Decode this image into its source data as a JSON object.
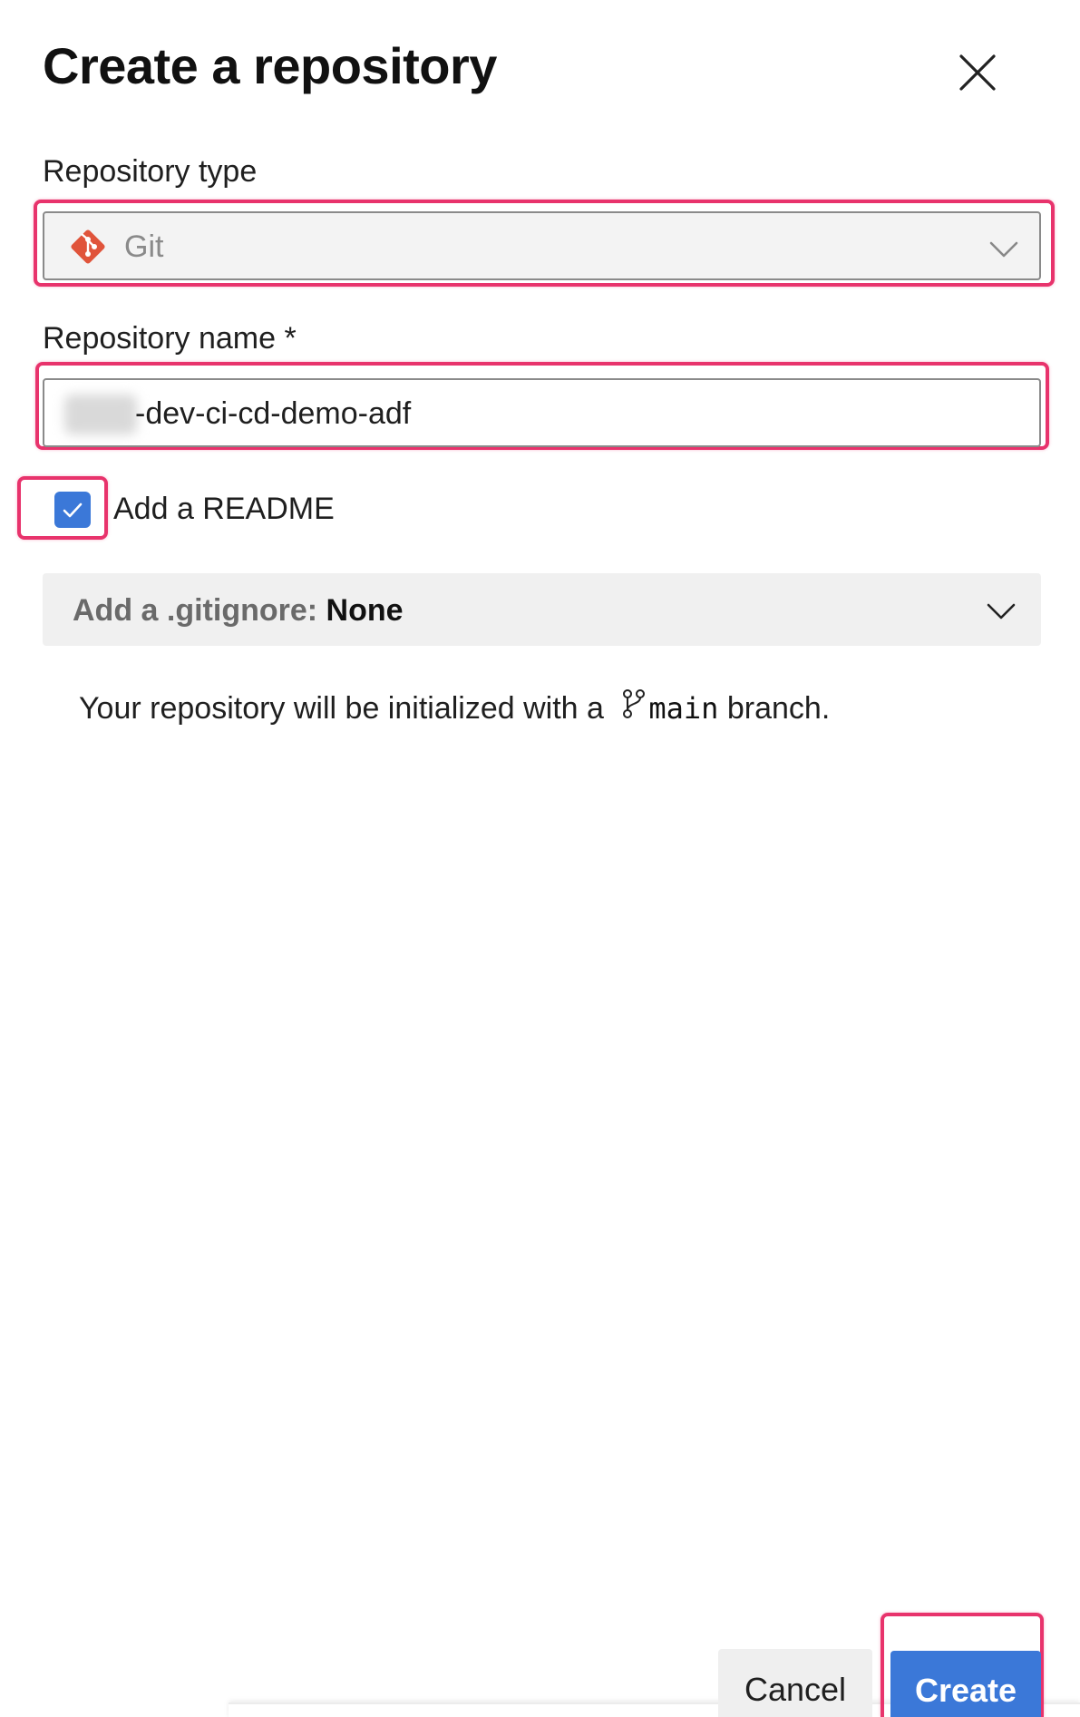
{
  "dialog": {
    "title": "Create a repository",
    "close_icon": "close-icon"
  },
  "repository_type": {
    "label": "Repository type",
    "value": "Git",
    "icon": "git-icon",
    "disabled": true
  },
  "repository_name": {
    "label": "Repository name *",
    "value": "-dev-ci-cd-demo-adf",
    "prefix_redacted": true
  },
  "readme": {
    "label": "Add a README",
    "checked": true
  },
  "gitignore": {
    "prefix": "Add a .gitignore: ",
    "value": "None"
  },
  "info": {
    "text_before": "Your repository will be initialized with a ",
    "branch_name": "main",
    "text_after": " branch.",
    "icon": "branch-icon"
  },
  "buttons": {
    "cancel_label": "Cancel",
    "create_label": "Create"
  },
  "colors": {
    "accent": "#3b78d8",
    "highlight": "#e8336c",
    "git": "#e0543b"
  }
}
